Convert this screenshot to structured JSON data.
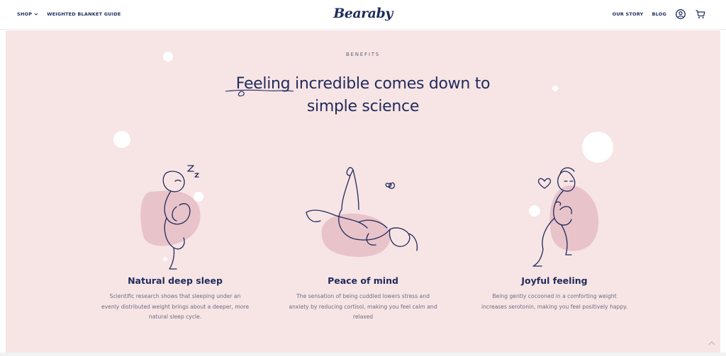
{
  "header": {
    "shop_label": "SHOP",
    "guide_label": "WEIGHTED BLANKET GUIDE",
    "logo": "Bearaby",
    "our_story_label": "OUR STORY",
    "blog_label": "BLOG",
    "icons": [
      "chevron-down-icon",
      "account-icon",
      "cart-icon"
    ]
  },
  "section": {
    "eyebrow": "BENEFITS",
    "headline_line1": "Feeling incredible comes down to",
    "headline_line2": "simple science"
  },
  "cards": [
    {
      "title": "Natural deep sleep",
      "description": "Scientific research shows that sleeping under an evenly distributed weight brings about a deeper, more natural sleep cycle.",
      "illustration": "sleeping-person-illustration"
    },
    {
      "title": "Peace of mind",
      "description": "The sensation of being cuddled lowers stress and anxiety by reducing cortisol, making you feel calm and relaxed",
      "illustration": "relaxed-lying-person-illustration"
    },
    {
      "title": "Joyful feeling",
      "description": "Being gently cocooned in a comforting weight increases serotonin, making you feel positively happy.",
      "illustration": "happy-hugging-person-illustration"
    }
  ],
  "colors": {
    "navy": "#1f2b5c",
    "section_bg": "#f7e4e4",
    "blob": "#e8c3c9",
    "text_muted": "#6b6f84"
  }
}
